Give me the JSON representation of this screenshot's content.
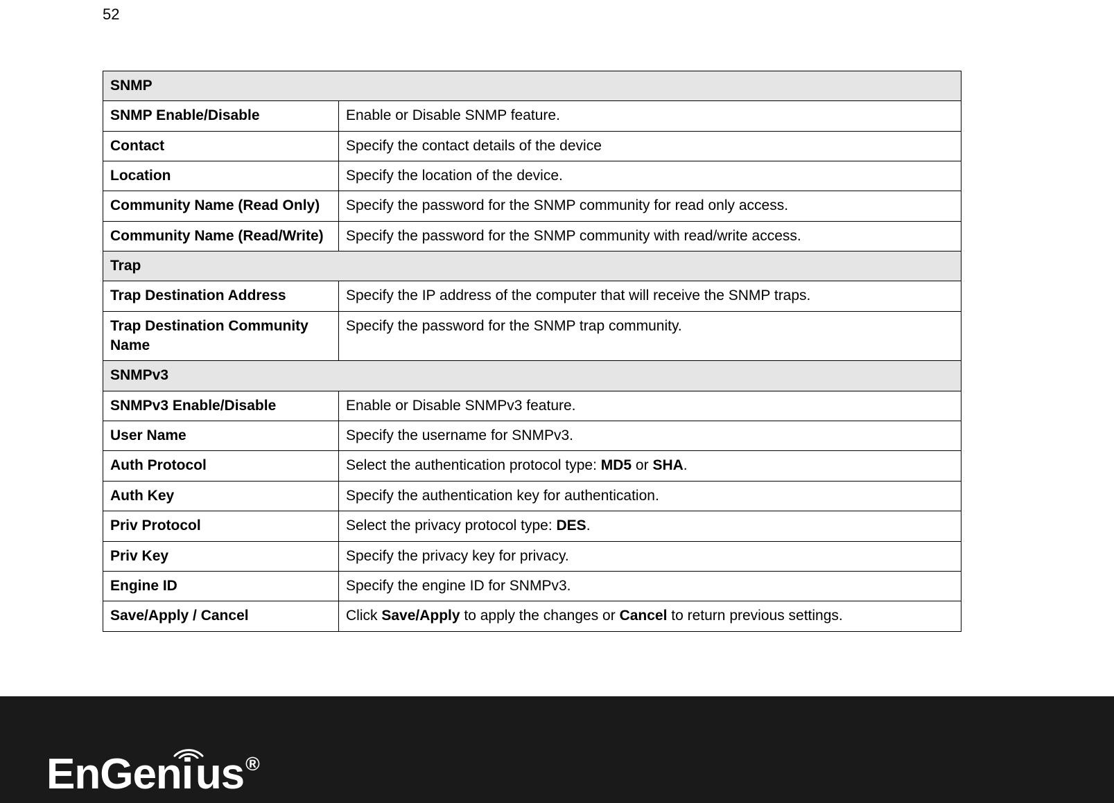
{
  "page_number": "52",
  "sections": [
    {
      "header": "SNMP",
      "rows": [
        {
          "label": "SNMP Enable/Disable",
          "desc_parts": [
            [
              "",
              "Enable or Disable SNMP feature."
            ]
          ]
        },
        {
          "label": "Contact",
          "desc_parts": [
            [
              "",
              "Specify the contact details of the device"
            ]
          ]
        },
        {
          "label": "Location",
          "desc_parts": [
            [
              "",
              "Specify the location of the device."
            ]
          ]
        },
        {
          "label": "Community Name (Read Only)",
          "desc_parts": [
            [
              "",
              "Specify the password for the SNMP community for read only access."
            ]
          ]
        },
        {
          "label": "Community Name (Read/Write)",
          "desc_parts": [
            [
              "",
              "Specify the password for the SNMP community with read/write access."
            ]
          ]
        }
      ]
    },
    {
      "header": "Trap",
      "rows": [
        {
          "label": "Trap Destination Address",
          "desc_parts": [
            [
              "",
              "Specify the IP address of the computer that will receive the SNMP traps."
            ]
          ]
        },
        {
          "label": "Trap Destination Community Name",
          "desc_parts": [
            [
              "",
              "Specify the password for the SNMP trap community."
            ]
          ]
        }
      ]
    },
    {
      "header": "SNMPv3",
      "rows": [
        {
          "label": "SNMPv3 Enable/Disable",
          "desc_parts": [
            [
              "",
              "Enable or Disable SNMPv3 feature."
            ]
          ]
        },
        {
          "label": "User Name",
          "desc_parts": [
            [
              "",
              "Specify the username for SNMPv3."
            ]
          ]
        },
        {
          "label": "Auth Protocol",
          "desc_parts": [
            [
              "",
              "Select the authentication protocol type: "
            ],
            [
              "b",
              "MD5"
            ],
            [
              "",
              " or "
            ],
            [
              "b",
              "SHA"
            ],
            [
              "",
              "."
            ]
          ]
        },
        {
          "label": "Auth Key",
          "desc_parts": [
            [
              "",
              "Specify the authentication key for authentication."
            ]
          ]
        },
        {
          "label": "Priv Protocol",
          "desc_parts": [
            [
              "",
              "Select the privacy protocol type: "
            ],
            [
              "b",
              "DES"
            ],
            [
              "",
              "."
            ]
          ]
        },
        {
          "label": "Priv Key",
          "desc_parts": [
            [
              "",
              "Specify the privacy key for privacy."
            ]
          ]
        },
        {
          "label": "Engine ID",
          "desc_parts": [
            [
              "",
              "Specify the engine ID for SNMPv3."
            ]
          ]
        },
        {
          "label": "Save/Apply / Cancel",
          "desc_parts": [
            [
              "",
              "Click "
            ],
            [
              "b",
              "Save/Apply"
            ],
            [
              "",
              " to apply the changes or "
            ],
            [
              "b",
              "Cancel"
            ],
            [
              "",
              " to return previous settings."
            ]
          ]
        }
      ]
    }
  ],
  "logo": {
    "brand_pre": "EnGen",
    "brand_i": "i",
    "brand_post": "us",
    "reg": "®"
  }
}
